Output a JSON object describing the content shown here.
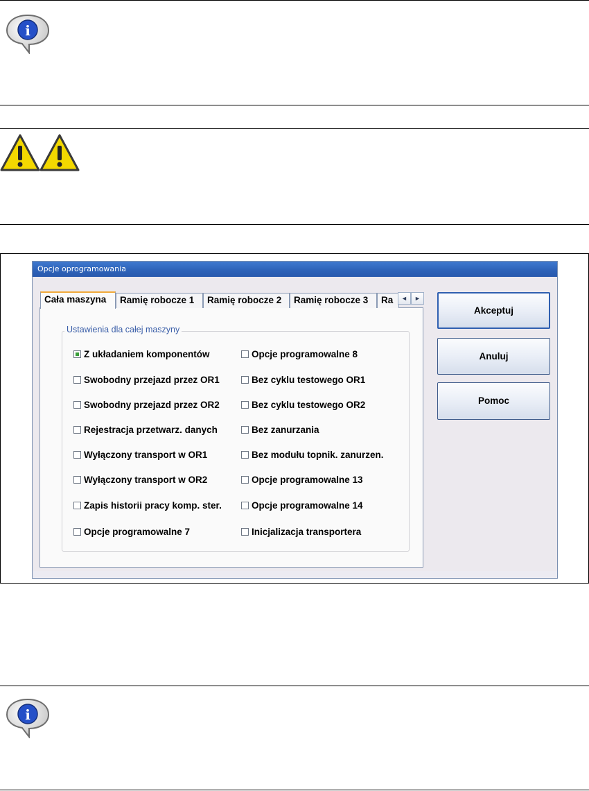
{
  "dialog": {
    "title": "Opcje oprogramowania",
    "tabs": [
      {
        "label": "Cała maszyna",
        "active": true
      },
      {
        "label": "Ramię robocze 1",
        "active": false
      },
      {
        "label": "Ramię robocze 2",
        "active": false
      },
      {
        "label": "Ramię robocze 3",
        "active": false
      },
      {
        "label": "Ra",
        "active": false
      }
    ],
    "tab_scroll": {
      "left": "◄",
      "right": "►"
    },
    "group_title": "Ustawienia dla całej maszyny",
    "options_left": [
      {
        "label": "Z układaniem komponentów",
        "checked": true
      },
      {
        "label": "Swobodny przejazd przez OR1",
        "checked": false
      },
      {
        "label": "Swobodny przejazd przez OR2",
        "checked": false
      },
      {
        "label": "Rejestracja przetwarz. danych",
        "checked": false
      },
      {
        "label": "Wyłączony transport w OR1",
        "checked": false
      },
      {
        "label": "Wyłączony transport w OR2",
        "checked": false
      },
      {
        "label": "Zapis historii pracy komp. ster.",
        "checked": false
      },
      {
        "label": "Opcje programowalne 7",
        "checked": false
      }
    ],
    "options_right": [
      {
        "label": "Opcje programowalne 8",
        "checked": false
      },
      {
        "label": "Bez cyklu testowego OR1",
        "checked": false
      },
      {
        "label": "Bez cyklu testowego OR2",
        "checked": false
      },
      {
        "label": "Bez zanurzania",
        "checked": false
      },
      {
        "label": "Bez modułu topnik. zanurzen.",
        "checked": false
      },
      {
        "label": "Opcje programowalne 13",
        "checked": false
      },
      {
        "label": "Opcje programowalne 14",
        "checked": false
      },
      {
        "label": "Inicjalizacja transportera",
        "checked": false
      }
    ],
    "buttons": {
      "accept": "Akceptuj",
      "cancel": "Anuluj",
      "help": "Pomoc"
    }
  },
  "icons": {
    "info": "info-speech-bubble-icon",
    "warning": "warning-triangle-icon"
  },
  "colors": {
    "titlebar": "#2e63b9",
    "active_tab_accent": "#f1a93a",
    "group_title": "#3a5ea8",
    "checked_mark": "#3a9e3a"
  }
}
